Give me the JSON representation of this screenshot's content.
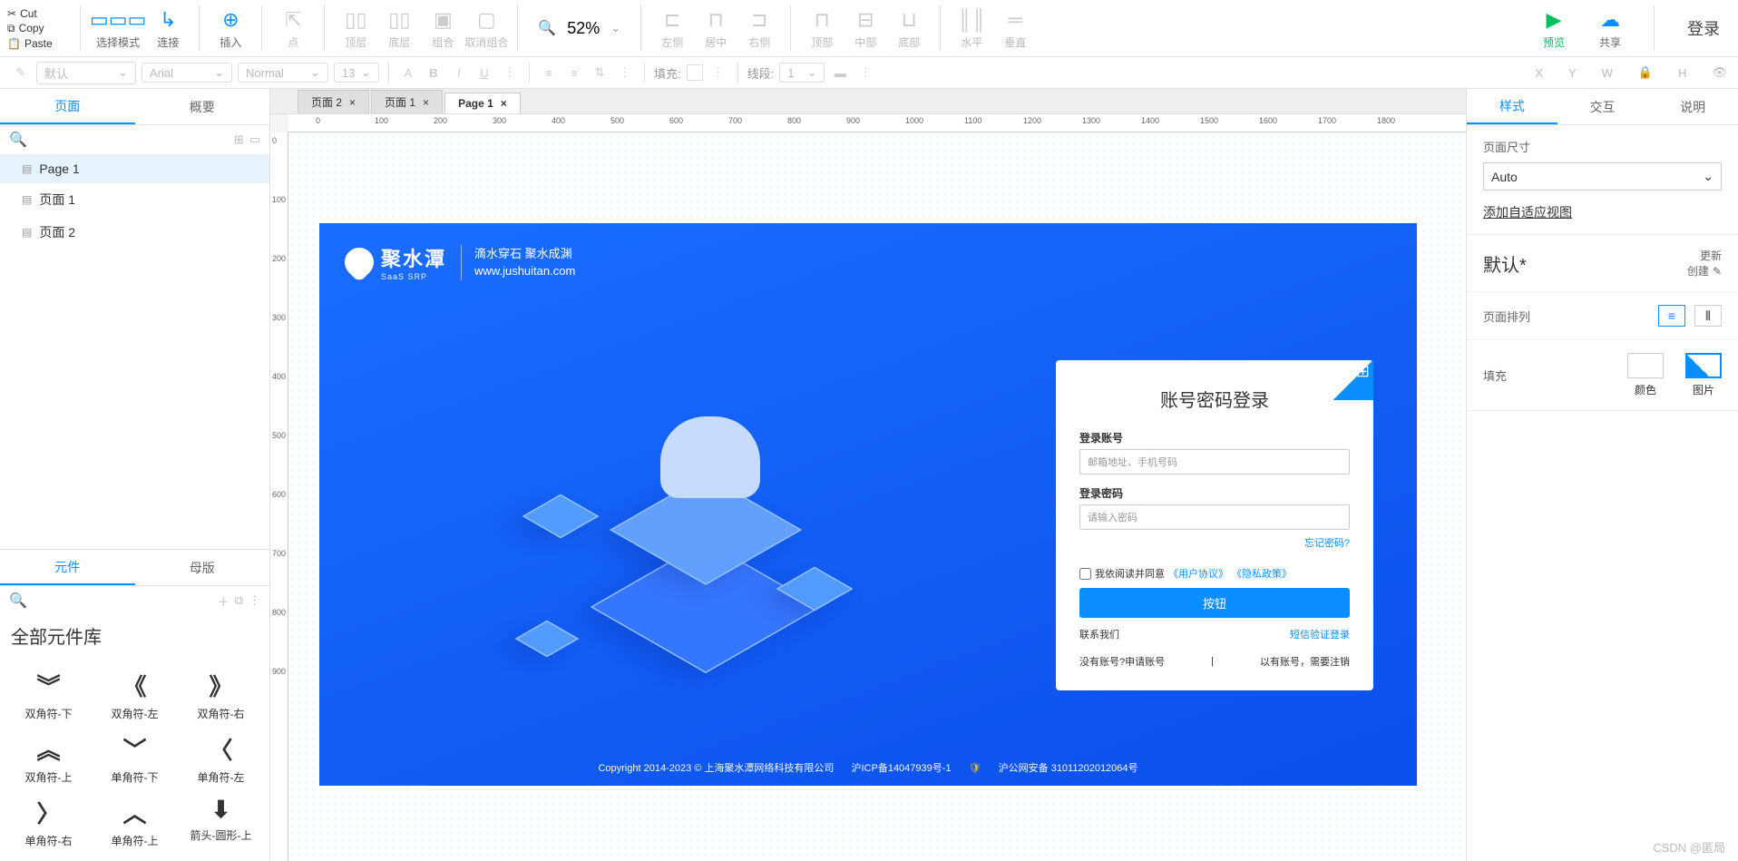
{
  "clipboard": {
    "cut": "Cut",
    "copy": "Copy",
    "paste": "Paste"
  },
  "toolbar1": {
    "select_mode": "选择模式",
    "connect": "连接",
    "insert": "插入",
    "point": "点",
    "top_layer": "顶层",
    "bottom_layer": "底层",
    "group": "组合",
    "ungroup": "取消组合",
    "zoom": "52%",
    "align_left": "左侧",
    "align_center": "居中",
    "align_right": "右侧",
    "align_top": "顶部",
    "align_middle": "中部",
    "align_bottom": "底部",
    "dist_h": "水平",
    "dist_v": "垂直",
    "preview": "预览",
    "share": "共享",
    "login": "登录"
  },
  "toolbar2": {
    "default": "默认",
    "font": "Arial",
    "weight": "Normal",
    "size": "13",
    "fill": "填充:",
    "line": "线段:",
    "line_val": "1",
    "x": "X",
    "y": "Y",
    "w": "W",
    "h": "H"
  },
  "left": {
    "tab_page": "页面",
    "tab_outline": "概要",
    "pages": [
      "Page 1",
      "页面 1",
      "页面 2"
    ],
    "tab_comp": "元件",
    "tab_master": "母版",
    "lib_title": "全部元件库",
    "comps": [
      {
        "g": "︾",
        "t": "双角符-下"
      },
      {
        "g": "《",
        "t": "双角符-左"
      },
      {
        "g": "》",
        "t": "双角符-右"
      },
      {
        "g": "︽",
        "t": "双角符-上"
      },
      {
        "g": "﹀",
        "t": "单角符-下"
      },
      {
        "g": "〈",
        "t": "单角符-左"
      },
      {
        "g": "〉",
        "t": "单角符-右"
      },
      {
        "g": "︿",
        "t": "单角符-上"
      },
      {
        "g": "⬇",
        "t": "箭头-圆形-上"
      }
    ]
  },
  "tabs": [
    {
      "label": "页面 2",
      "active": false
    },
    {
      "label": "页面 1",
      "active": false
    },
    {
      "label": "Page 1",
      "active": true
    }
  ],
  "hruler": [
    0,
    100,
    200,
    300,
    400,
    500,
    600,
    700,
    800,
    900,
    1000,
    1100,
    1200,
    1300,
    1400,
    1500,
    1600,
    1700,
    1800
  ],
  "vruler": [
    0,
    100,
    200,
    300,
    400,
    500,
    600,
    700,
    800,
    900
  ],
  "design": {
    "brand": "聚水潭",
    "brand_sub": "SaaS SRP",
    "slogan1": "滴水穿石 聚水成渊",
    "slogan2": "www.jushuitan.com",
    "card": {
      "title": "账号密码登录",
      "user_label": "登录账号",
      "user_ph": "邮箱地址、手机号码",
      "pwd_label": "登录密码",
      "pwd_ph": "请输入密码",
      "forgot": "忘记密码?",
      "agree_pre": "我依阅读并同意",
      "agree_a1": "《用户协议》",
      "agree_a2": "《隐私政策》",
      "btn": "按钮",
      "contact": "联系我们",
      "sms": "短信验证登录",
      "reg": "没有账号?申请账号",
      "sep": "|",
      "logout": "以有账号，需要注销"
    },
    "footer": {
      "copy": "Copyright 2014-2023 © 上海聚水潭网络科技有限公司",
      "icp": "沪ICP备14047939号-1",
      "gov": "沪公网安备 31011202012064号"
    }
  },
  "right": {
    "tab_style": "样式",
    "tab_interact": "交互",
    "tab_note": "说明",
    "size_label": "页面尺寸",
    "size_val": "Auto",
    "adaptive": "添加自适应视图",
    "default_label": "默认*",
    "update": "更新",
    "create": "创建",
    "arrange_label": "页面排列",
    "fill_label": "填充",
    "color": "颜色",
    "image": "图片"
  },
  "watermark": "CSDN @匿局"
}
